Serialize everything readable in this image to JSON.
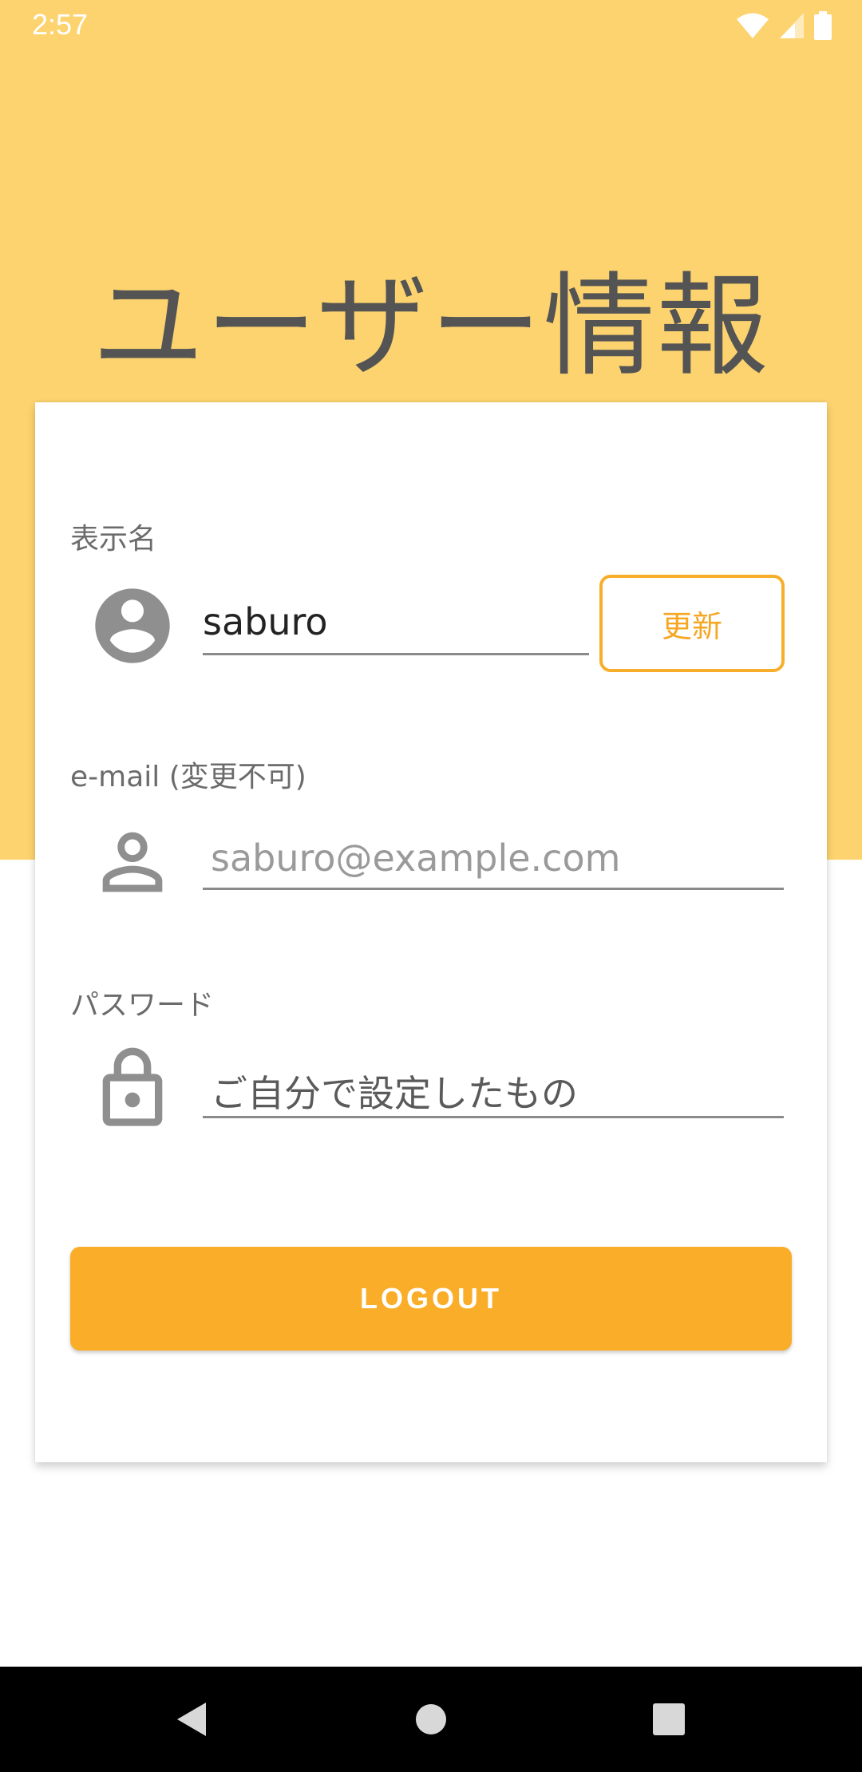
{
  "status_bar": {
    "time": "2:57",
    "icons": [
      "wifi-icon",
      "cellular-signal-icon",
      "battery-icon"
    ]
  },
  "page": {
    "title": "ユーザー情報"
  },
  "display_name": {
    "label": "表示名",
    "value": "saburo",
    "icon": "account-circle-icon",
    "update_button_label": "更新"
  },
  "email": {
    "label": "e-mail (変更不可)",
    "value": "saburo@example.com",
    "icon": "person-outline-icon"
  },
  "password": {
    "label": "パスワード",
    "value": "ご自分で設定したもの",
    "icon": "lock-icon"
  },
  "logout_button_label": "LOGOUT",
  "nav_bar": {
    "buttons": [
      "back-icon",
      "home-icon",
      "recents-icon"
    ]
  },
  "colors": {
    "header_background": "#FCD36E",
    "accent": "#F9AD28",
    "title_text": "#545454"
  }
}
